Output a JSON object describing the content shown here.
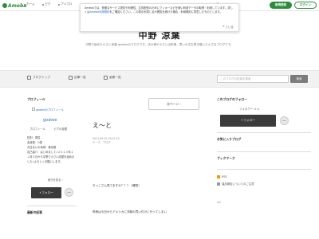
{
  "header": {
    "logo_text": "Ameba",
    "nav": [
      "ホーム",
      "ピグ",
      "アメブロ"
    ],
    "user_label": "人気ブログ",
    "signup": "新規登録",
    "login": "ログイン"
  },
  "cookie": {
    "text_before": "Amebaでは、快適なサービス提供や利便性、広告配信のためにクッキーなどを使い利用データの取得・利用しています。詳しくは",
    "link": "Ameba利用規約",
    "text_after": "をご確認ください。この表示を閉じるか閲覧を続けた場合、利用規約に同意したものとします。",
    "close": "とじる"
  },
  "blog": {
    "title": "中野 涼葉",
    "description": "中野で始めた小さい涼葉 goateeのブログです。店の事や小さい出来事、思いの丈を書き綴った小さなブログです。"
  },
  "navbar": {
    "items": [
      "ブログトップ",
      "記事一覧",
      "画像一覧"
    ],
    "search_placeholder": "このブログの記事を検索",
    "search_button": "検索"
  },
  "left": {
    "profile_heading": "プロフィール",
    "profile_image_alt": "goateeのプロフィール",
    "name": "goatee",
    "tabs": [
      "プロフィール",
      "ピグの部屋"
    ],
    "info": [
      "性別：男性",
      "血液型：O型",
      "お住まいの地域：東京都",
      "自己紹介：はじめまして♪２０１３年１２月４日から中野で小さい床屋を始めました♪よろしくお願いします。"
    ],
    "more": "続きを見る",
    "follow": "+フォロー",
    "latest_heading": "最新の記事"
  },
  "main": {
    "next_page": "次ページ",
    "entry_title": "え～と",
    "entry_date": "2011-09-01 00:21:22",
    "entry_theme": "テーマ：ブログ",
    "line1": "ネっこさん見てますか？？？（爆笑）",
    "line2": "昨夜は今日からアメリカに洋服の買い付けに行ってしまい"
  },
  "right": {
    "follow_heading": "このブログのフォロー",
    "follower_count": "フォロワー 4 人",
    "follow": "+フォロー",
    "osusume_heading": "お気に入りブログ",
    "bookmark_heading": "ブックマーク",
    "rss": "RSS",
    "report": "違反報告についてのご注意",
    "ad": "AD"
  }
}
